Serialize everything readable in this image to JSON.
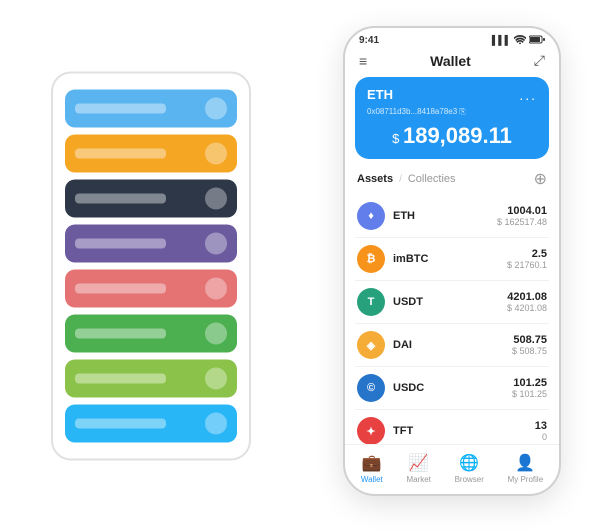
{
  "scene": {
    "card_stack": {
      "items": [
        {
          "color": "card-blue",
          "bar_width": "55%"
        },
        {
          "color": "card-orange",
          "bar_width": "60%"
        },
        {
          "color": "card-dark",
          "bar_width": "50%"
        },
        {
          "color": "card-purple",
          "bar_width": "65%"
        },
        {
          "color": "card-red",
          "bar_width": "58%"
        },
        {
          "color": "card-green",
          "bar_width": "62%"
        },
        {
          "color": "card-light-green",
          "bar_width": "55%"
        },
        {
          "color": "card-sky",
          "bar_width": "60%"
        }
      ]
    }
  },
  "phone": {
    "status_bar": {
      "time": "9:41",
      "signal": "▌▌▌",
      "wifi": "WiFi",
      "battery": "🔋"
    },
    "header": {
      "menu_icon": "≡",
      "title": "Wallet",
      "expand_icon": "⤢"
    },
    "eth_card": {
      "name": "ETH",
      "address": "0x08711d3b...8418a78e3",
      "copy_icon": "⎘",
      "dots": "...",
      "balance_symbol": "$ ",
      "balance": "189,089.11"
    },
    "assets_section": {
      "tab_active": "Assets",
      "tab_divider": "/",
      "tab_inactive": "Collecties",
      "add_icon": "⊕"
    },
    "assets": [
      {
        "icon": "♦",
        "icon_color": "#627eea",
        "name": "ETH",
        "amount": "1004.01",
        "usd": "$ 162517.48"
      },
      {
        "icon": "₿",
        "icon_color": "#f7931a",
        "name": "imBTC",
        "amount": "2.5",
        "usd": "$ 21760.1"
      },
      {
        "icon": "T",
        "icon_color": "#26a17b",
        "name": "USDT",
        "amount": "4201.08",
        "usd": "$ 4201.08"
      },
      {
        "icon": "◈",
        "icon_color": "#f5ac37",
        "name": "DAI",
        "amount": "508.75",
        "usd": "$ 508.75"
      },
      {
        "icon": "©",
        "icon_color": "#2775ca",
        "name": "USDC",
        "amount": "101.25",
        "usd": "$ 101.25"
      },
      {
        "icon": "🌊",
        "icon_color": "#e84142",
        "name": "TFT",
        "amount": "13",
        "usd": "0"
      }
    ],
    "bottom_nav": [
      {
        "icon": "💼",
        "label": "Wallet",
        "active": true
      },
      {
        "icon": "📈",
        "label": "Market",
        "active": false
      },
      {
        "icon": "🌐",
        "label": "Browser",
        "active": false
      },
      {
        "icon": "👤",
        "label": "My Profile",
        "active": false
      }
    ]
  }
}
